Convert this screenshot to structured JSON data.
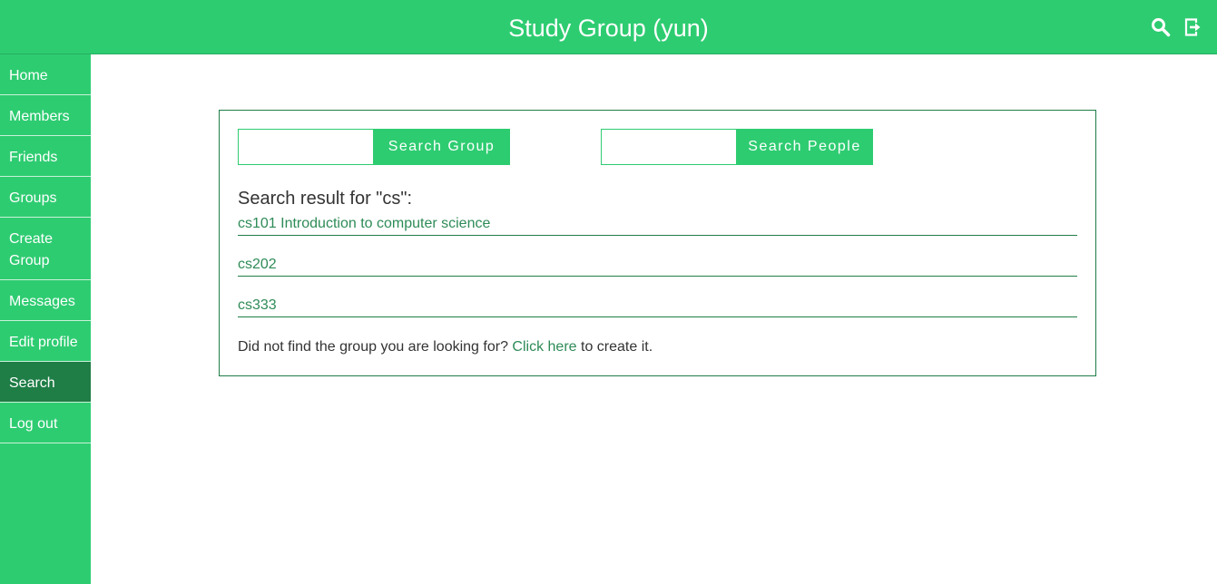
{
  "header": {
    "title": "Study Group (yun)",
    "icons": [
      "search-icon",
      "logout-icon"
    ],
    "background": "#2ecc71"
  },
  "sidebar": {
    "items": [
      {
        "label": "Home"
      },
      {
        "label": "Members"
      },
      {
        "label": "Friends"
      },
      {
        "label": "Groups"
      },
      {
        "label": "Create Group"
      },
      {
        "label": "Messages"
      },
      {
        "label": "Edit profile"
      },
      {
        "label": "Search",
        "active": true
      },
      {
        "label": "Log out"
      }
    ],
    "active_color": "#1f7d46"
  },
  "search": {
    "group_input_value": "",
    "group_button_label": "Search Group",
    "people_input_value": "",
    "people_button_label": "Search People"
  },
  "results": {
    "heading": "Search result for \"cs\":",
    "items": [
      "cs101 Introduction to computer science",
      "cs202",
      "cs333"
    ],
    "footer_prefix": "Did not find the group you are looking for?",
    "footer_link": "Click here",
    "footer_suffix": "to create it."
  },
  "colors": {
    "accent": "#2ecc71",
    "accent_dark": "#1f7d46",
    "link": "#2e8b57"
  }
}
